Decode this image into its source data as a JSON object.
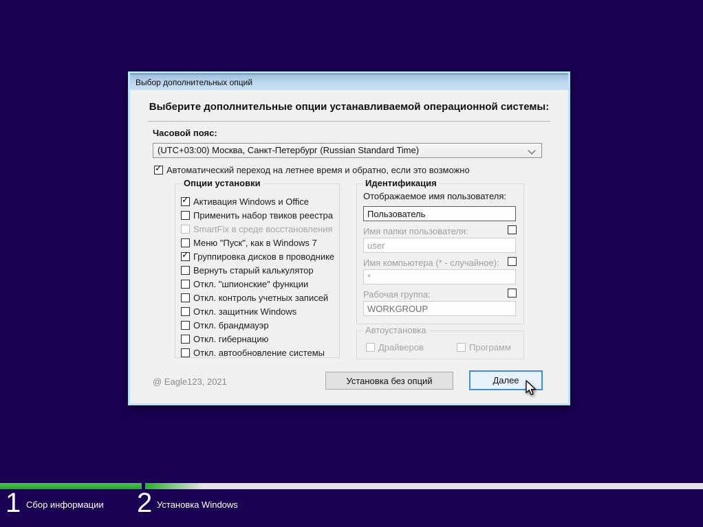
{
  "dialog": {
    "title": "Выбор дополнительных опций",
    "heading": "Выберите дополнительные опции устанавливаемой операционной системы:",
    "timezone": {
      "label": "Часовой пояс:",
      "value": "(UTC+03:00) Москва, Санкт-Петербург (Russian Standard Time)"
    },
    "dst_checkbox": {
      "label": "Автоматический переход на летнее время и обратно, если это возможно",
      "checked": true
    },
    "install_options": {
      "title": "Опции установки",
      "items": [
        {
          "label": "Активация Windows и Office",
          "checked": true,
          "disabled": false
        },
        {
          "label": "Применить набор твиков реестра",
          "checked": false,
          "disabled": false
        },
        {
          "label": "SmartFix в среде восстановления",
          "checked": false,
          "disabled": true
        },
        {
          "label": "Меню \"Пуск\", как в Windows 7",
          "checked": false,
          "disabled": false
        },
        {
          "label": "Группировка дисков в проводнике",
          "checked": true,
          "disabled": false
        },
        {
          "label": "Вернуть старый калькулятор",
          "checked": false,
          "disabled": false
        },
        {
          "label": "Откл. \"шпионские\" функции",
          "checked": false,
          "disabled": false
        },
        {
          "label": "Откл. контроль учетных записей",
          "checked": false,
          "disabled": false
        },
        {
          "label": "Откл. защитник Windows",
          "checked": false,
          "disabled": false
        },
        {
          "label": "Откл. брандмауэр",
          "checked": false,
          "disabled": false
        },
        {
          "label": "Откл. гибернацию",
          "checked": false,
          "disabled": false
        },
        {
          "label": "Откл. автообновление системы",
          "checked": false,
          "disabled": false
        }
      ]
    },
    "identification": {
      "title": "Идентификация",
      "fields": [
        {
          "label": "Отображаемое имя пользователя:",
          "value": "Пользователь",
          "has_checkbox": false,
          "disabled": false
        },
        {
          "label": "Имя папки пользователя:",
          "value": "user",
          "has_checkbox": true,
          "checked": false,
          "disabled": true
        },
        {
          "label": "Имя компьютера (* - случайное):",
          "value": "*",
          "has_checkbox": true,
          "checked": false,
          "disabled": true
        },
        {
          "label": "Рабочая группа:",
          "value": "WORKGROUP",
          "has_checkbox": true,
          "checked": false,
          "disabled": true
        }
      ]
    },
    "autoinstall": {
      "title": "Автоустановка",
      "items": [
        {
          "label": "Драйверов",
          "checked": false,
          "disabled": true
        },
        {
          "label": "Программ",
          "checked": false,
          "disabled": true
        }
      ]
    },
    "credit": "@ Eagle123, 2021",
    "buttons": {
      "no_options": "Установка без опций",
      "next": "Далее"
    }
  },
  "setup_steps": {
    "steps": [
      {
        "number": "1",
        "label": "Сбор информации",
        "progress_percent": 100
      },
      {
        "number": "2",
        "label": "Установка Windows",
        "progress_percent": 10
      }
    ]
  },
  "icons": {
    "checkmark": "✓"
  },
  "colors": {
    "desktop_background": "#1b0153",
    "titlebar_gradient_top": "#9fbedd",
    "titlebar_gradient_bottom": "#c9def2",
    "dialog_frame": "#b9e3f8",
    "dialog_body": "#f0f0f0",
    "progress_green": "#2db42d",
    "progress_track": "#e4e4e4",
    "next_button_fill": "#e7f2fc",
    "next_button_border": "#3e8ddb"
  }
}
